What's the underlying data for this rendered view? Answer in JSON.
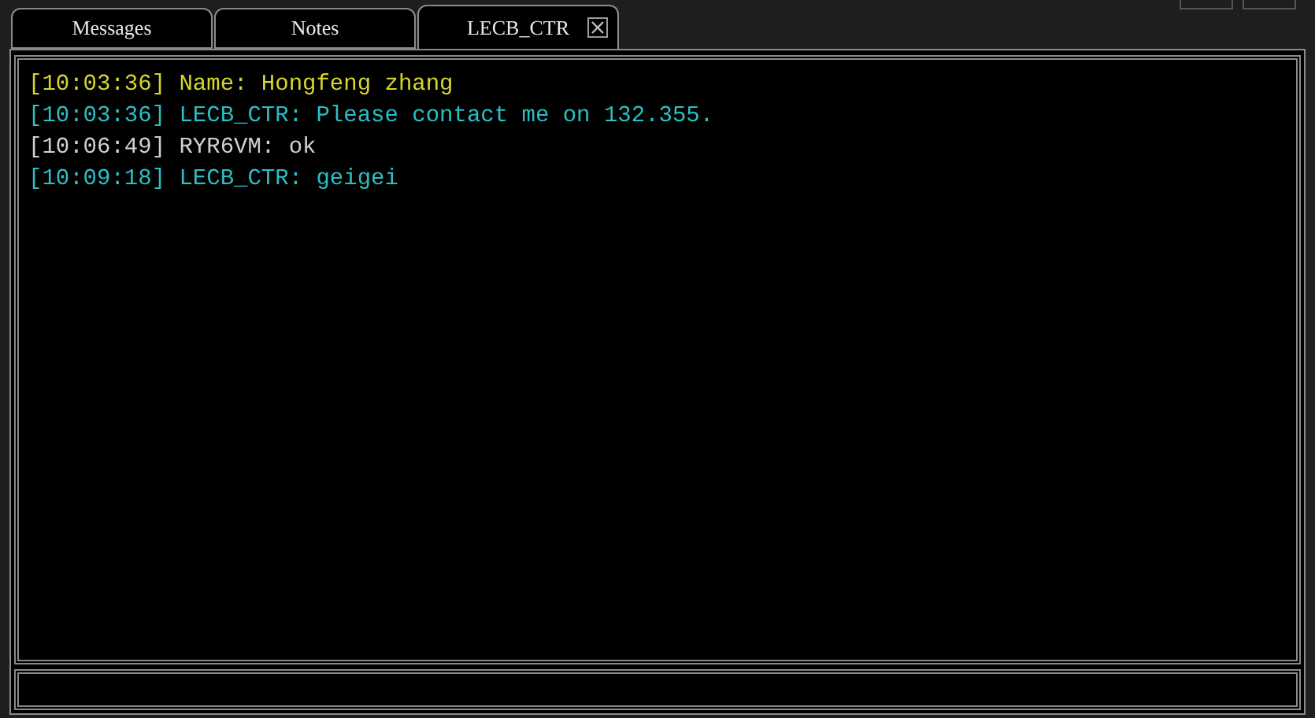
{
  "tabs": [
    {
      "label": "Messages",
      "selected": false,
      "closable": false
    },
    {
      "label": "Notes",
      "selected": false,
      "closable": false
    },
    {
      "label": "LECB_CTR",
      "selected": true,
      "closable": true
    }
  ],
  "messages": [
    {
      "time": "[10:03:36]",
      "text": "Name: Hongfeng zhang",
      "color": "#d6d62c"
    },
    {
      "time": "[10:03:36]",
      "text": "LECB_CTR: Please contact me on 132.355.",
      "color": "#2cbfc4"
    },
    {
      "time": "[10:06:49]",
      "text": "RYR6VM: ok",
      "color": "#d0d0d0"
    },
    {
      "time": "[10:09:18]",
      "text": "LECB_CTR: geigei",
      "color": "#2cbfc4"
    }
  ]
}
